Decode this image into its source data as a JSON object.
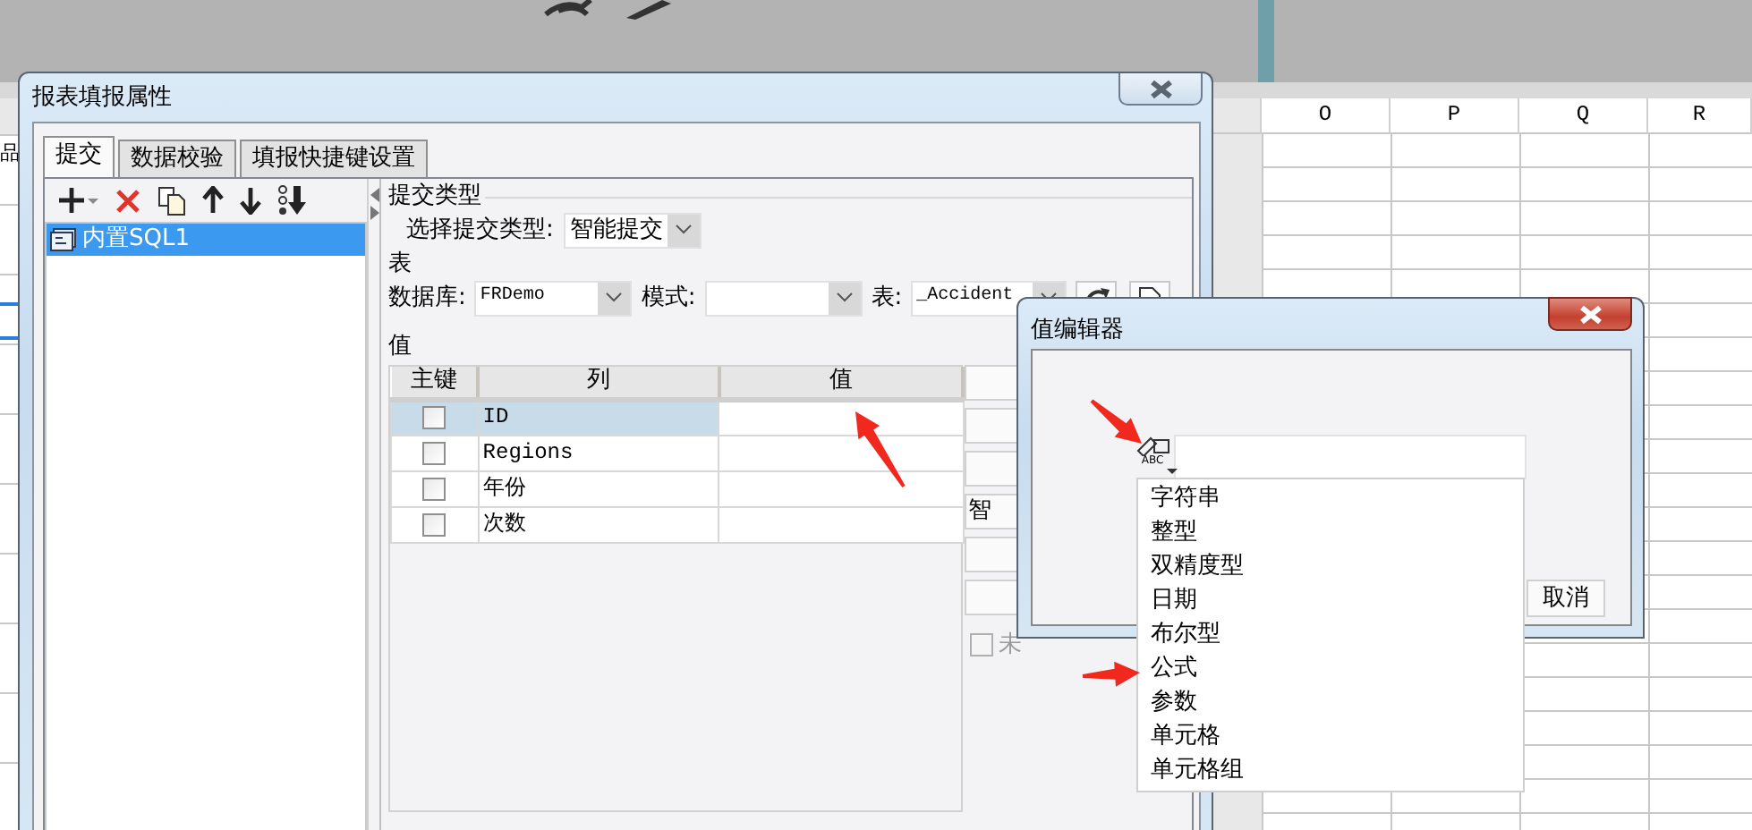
{
  "spreadsheet": {
    "left_cell": "品",
    "columns": [
      "O",
      "P",
      "Q",
      "R"
    ]
  },
  "report_dialog": {
    "title": "报表填报属性",
    "tabs": [
      {
        "label": "提交",
        "selected": true
      },
      {
        "label": "数据校验",
        "selected": false
      },
      {
        "label": "填报快捷键设置",
        "selected": false
      }
    ],
    "sources": [
      {
        "label": "内置SQL1",
        "selected": true
      }
    ],
    "submit_group": "提交类型",
    "submit_type": {
      "label": "选择提交类型:",
      "value": "智能提交"
    },
    "table_group": "表",
    "database": {
      "label": "数据库:",
      "value": "FRDemo"
    },
    "schema": {
      "label": "模式:"
    },
    "table": {
      "label": "表:",
      "value": "_Accident"
    },
    "values_group": "值",
    "grid": {
      "columns": [
        "主键",
        "列",
        "值"
      ],
      "rows": [
        {
          "primary_key": false,
          "column": "ID",
          "selected": true
        },
        {
          "primary_key": false,
          "column": "Regions",
          "selected": false
        },
        {
          "primary_key": false,
          "column": "年份",
          "selected": false
        },
        {
          "primary_key": false,
          "column": "次数",
          "selected": false
        }
      ]
    },
    "side_buttons": [
      {
        "kind": "blank"
      },
      {
        "kind": "blank"
      },
      {
        "kind": "blank"
      },
      {
        "kind": "text",
        "label": "智"
      },
      {
        "kind": "blank"
      },
      {
        "kind": "blank"
      }
    ],
    "unchanged_option": {
      "label": "未",
      "checked": false,
      "disabled": true
    }
  },
  "value_editor": {
    "title": "值编辑器",
    "type_button": "ABC",
    "type_menu": [
      "字符串",
      "整型",
      "双精度型",
      "日期",
      "布尔型",
      "公式",
      "参数",
      "单元格",
      "单元格组"
    ],
    "cancel": "取消"
  }
}
